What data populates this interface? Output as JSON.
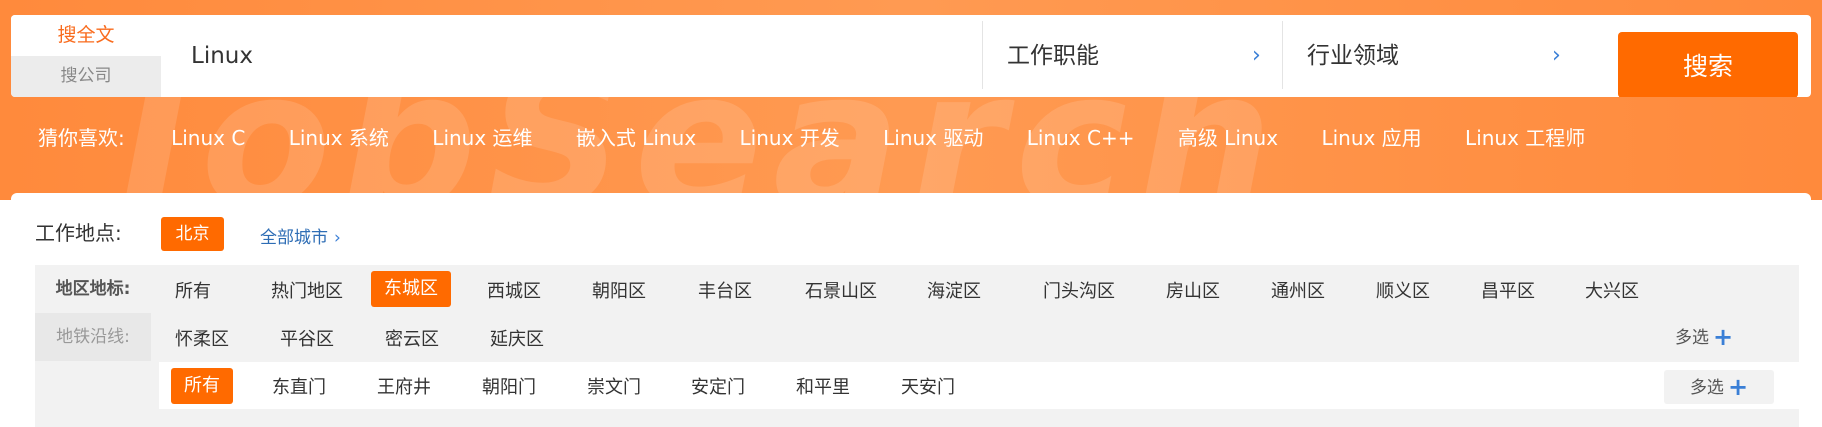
{
  "search": {
    "mode_active": "搜全文",
    "mode_inactive": "搜公司",
    "query": "Linux",
    "job_function": "工作职能",
    "industry": "行业领域",
    "button": "搜索",
    "chevron": "›"
  },
  "banner": {
    "watermark": "JobSearch",
    "guess_label": "猜你喜欢:",
    "guess_items": [
      "Linux C",
      "Linux 系统",
      "Linux 运维",
      "嵌入式 Linux",
      "Linux 开发",
      "Linux 驱动",
      "Linux C++",
      "高级 Linux",
      "Linux 应用",
      "Linux 工程师"
    ]
  },
  "filters": {
    "location_label": "工作地点:",
    "city": "北京",
    "all_cities": "全部城市",
    "chevron": "›",
    "area_tab": "地区地标:",
    "subway_tab": "地铁沿线:",
    "districts": [
      "所有",
      "热门地区",
      "东城区",
      "西城区",
      "朝阳区",
      "丰台区",
      "石景山区",
      "海淀区",
      "门头沟区",
      "房山区",
      "通州区",
      "顺义区",
      "昌平区",
      "大兴区",
      "怀柔区",
      "平谷区",
      "密云区",
      "延庆区"
    ],
    "selected_district": "东城区",
    "stations": [
      "所有",
      "东直门",
      "王府井",
      "朝阳门",
      "崇文门",
      "安定门",
      "和平里",
      "天安门"
    ],
    "selected_station": "所有",
    "multi_select": "多选",
    "plus": "+"
  },
  "colors": {
    "accent": "#ff6a00",
    "banner": "#ff8a3c",
    "link": "#2e6db5"
  }
}
